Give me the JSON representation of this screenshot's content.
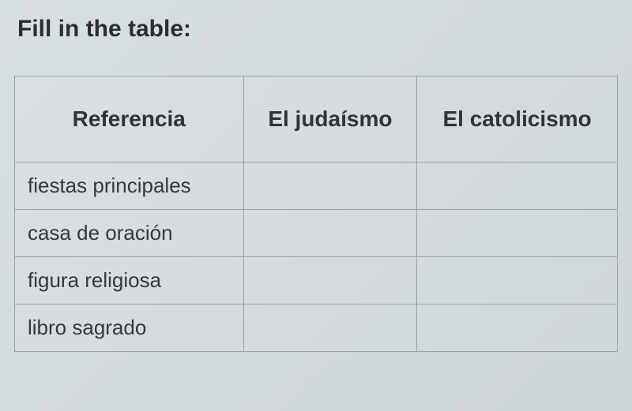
{
  "instruction": "Fill in the table:",
  "headers": {
    "col1": "Referencia",
    "col2": "El judaísmo",
    "col3": "El catolicismo"
  },
  "rows": [
    {
      "label": "fiestas principales",
      "col2": "",
      "col3": ""
    },
    {
      "label": "casa de oración",
      "col2": "",
      "col3": ""
    },
    {
      "label": "figura religiosa",
      "col2": "",
      "col3": ""
    },
    {
      "label": "libro sagrado",
      "col2": "",
      "col3": ""
    }
  ]
}
